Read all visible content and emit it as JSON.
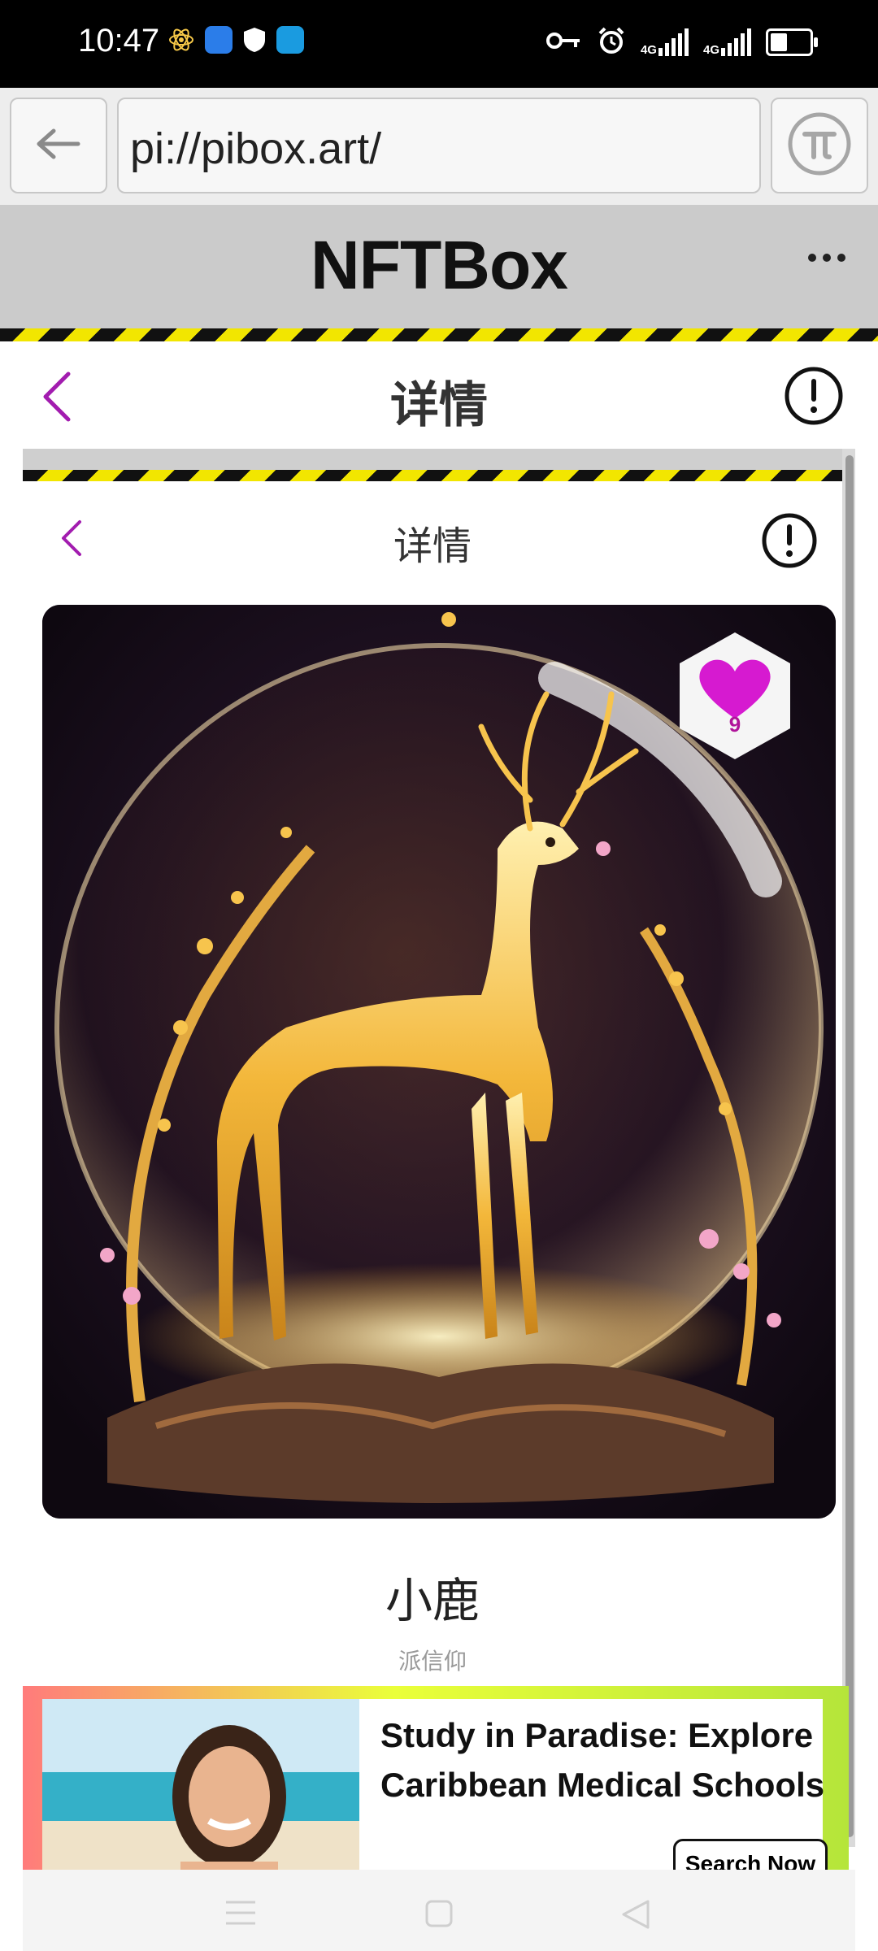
{
  "status_bar": {
    "time": "10:47",
    "network_1": "4G",
    "network_2": "4G",
    "icons": [
      "atom-icon",
      "browser-icon",
      "shield-icon",
      "chat-icon",
      "key-icon",
      "alarm-icon",
      "signal-icon",
      "signal-icon",
      "battery-icon"
    ]
  },
  "browser": {
    "url": "pi://pibox.art/",
    "back_icon": "arrow-left-icon",
    "pi_icon": "pi-icon"
  },
  "app": {
    "title": "NFTBox",
    "more_icon": "more-dots-icon"
  },
  "detail_header": {
    "title": "详情",
    "back_icon": "chevron-left-icon",
    "info_icon": "exclamation-circle-icon"
  },
  "embedded_header": {
    "title": "详情"
  },
  "nft": {
    "name": "小鹿",
    "author": "派信仰",
    "likes": "9"
  },
  "ad": {
    "headline": "Study in Paradise: Explore Caribbean Medical Schools",
    "cta": "Search Now"
  },
  "colors": {
    "accent": "#a21caf",
    "heart": "#d61ad0",
    "hazard_yellow": "#f2e600",
    "header_gray": "#cbcbcb"
  }
}
